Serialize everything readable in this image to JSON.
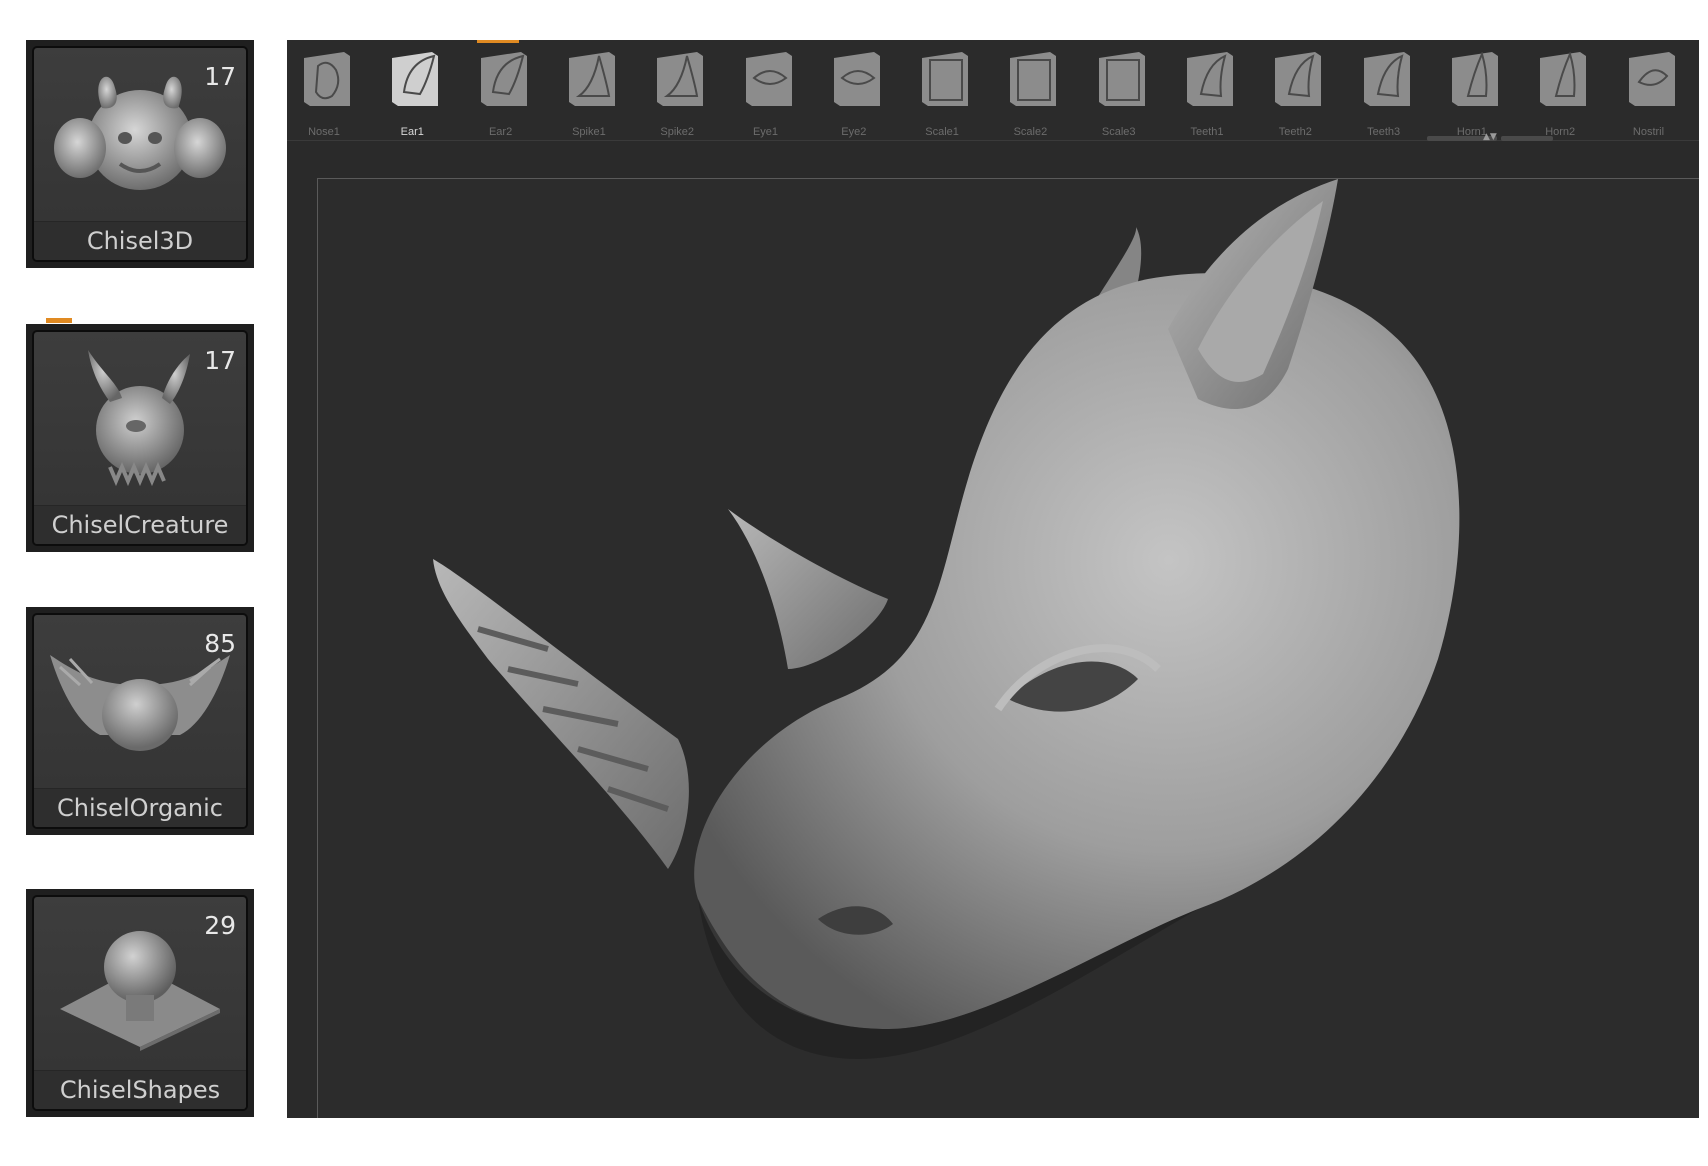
{
  "brush_library": [
    {
      "label": "Chisel3D",
      "count": "17",
      "icon": "chisel3d-thumbnail-icon"
    },
    {
      "label": "ChiselCreature",
      "count": "17",
      "icon": "chisel-creature-thumbnail-icon"
    },
    {
      "label": "ChiselOrganic",
      "count": "85",
      "icon": "chisel-organic-thumbnail-icon"
    },
    {
      "label": "ChiselShapes",
      "count": "29",
      "icon": "chisel-shapes-thumbnail-icon"
    }
  ],
  "shelf": {
    "active_index": 1,
    "items": [
      {
        "label": "Nose1",
        "icon": "nose-alpha-icon"
      },
      {
        "label": "Ear1",
        "icon": "ear-alpha-icon"
      },
      {
        "label": "Ear2",
        "icon": "ear-alpha-icon"
      },
      {
        "label": "Spike1",
        "icon": "spike-alpha-icon"
      },
      {
        "label": "Spike2",
        "icon": "spike-alpha-icon"
      },
      {
        "label": "Eye1",
        "icon": "eye-alpha-icon"
      },
      {
        "label": "Eye2",
        "icon": "eye-alpha-icon"
      },
      {
        "label": "Scale1",
        "icon": "scale-alpha-icon"
      },
      {
        "label": "Scale2",
        "icon": "scale-alpha-icon"
      },
      {
        "label": "Scale3",
        "icon": "scale-alpha-icon"
      },
      {
        "label": "Teeth1",
        "icon": "teeth-alpha-icon"
      },
      {
        "label": "Teeth2",
        "icon": "teeth-alpha-icon"
      },
      {
        "label": "Teeth3",
        "icon": "teeth-alpha-icon"
      },
      {
        "label": "Horn1",
        "icon": "horn-alpha-icon"
      },
      {
        "label": "Horn2",
        "icon": "horn-alpha-icon"
      },
      {
        "label": "Nostril",
        "icon": "nostril-alpha-icon"
      }
    ]
  },
  "colors": {
    "accent": "#e08a22",
    "panel": "#2a2a2a",
    "tile_bg": "#353535",
    "clay": "#9a9a9a"
  }
}
